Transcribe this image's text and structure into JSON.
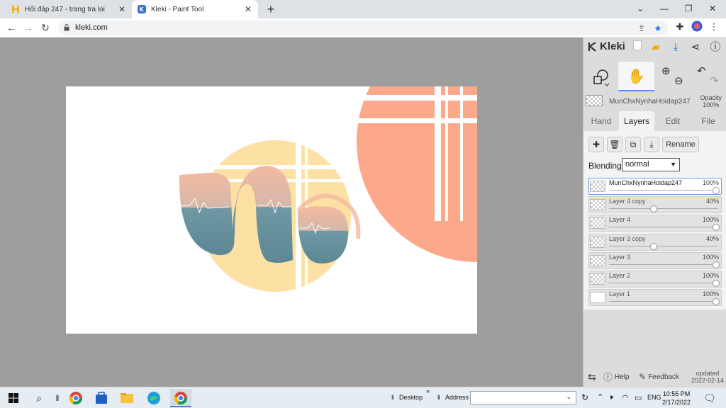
{
  "browser": {
    "tabs": [
      {
        "title": "Hỏi đáp 247 - trang tra loi",
        "active": false
      },
      {
        "title": "Kleki - Paint Tool",
        "active": true
      }
    ],
    "url": "kleki.com",
    "accent": "#1a73e8"
  },
  "app": {
    "logo": "Kleki",
    "current_layer_name": "MunChxNynhaHoidap247",
    "opacity_label": "Opacity",
    "opacity_value": "100%",
    "panel_tabs": [
      "Hand",
      "Layers",
      "Edit",
      "File"
    ],
    "active_panel_tab": "Layers",
    "rename_label": "Rename",
    "blending_label": "Blending",
    "blending_value": "normal",
    "layers": [
      {
        "name": "MunChxNynhaHoidap247",
        "opacity": "100%",
        "level": 1.0,
        "active": true
      },
      {
        "name": "Layer 4 copy",
        "opacity": "40%",
        "level": 0.4,
        "active": false
      },
      {
        "name": "Layer 4",
        "opacity": "100%",
        "level": 1.0,
        "active": false
      },
      {
        "name": "Layer 3 copy",
        "opacity": "40%",
        "level": 0.4,
        "active": false
      },
      {
        "name": "Layer 3",
        "opacity": "100%",
        "level": 1.0,
        "active": false
      },
      {
        "name": "Layer 2",
        "opacity": "100%",
        "level": 1.0,
        "active": false
      },
      {
        "name": "Layer 1",
        "opacity": "100%",
        "level": 1.0,
        "active": false
      }
    ],
    "footer": {
      "help": "Help",
      "feedback": "Feedback",
      "updated_label": "updated",
      "updated_date": "2022-02-14"
    }
  },
  "taskbar": {
    "desktop_label": "Desktop",
    "address_label": "Address",
    "language": "ENG",
    "time": "10:55 PM",
    "date": "2/17/2022"
  },
  "colors": {
    "peach": "#fba98a",
    "yellow": "#fde0a3",
    "teal": "#6f98a5"
  }
}
